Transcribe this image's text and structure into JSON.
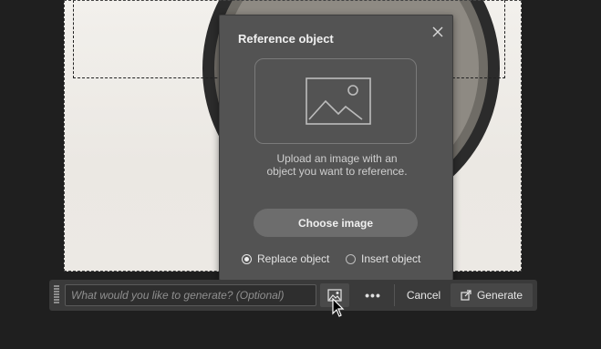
{
  "popup": {
    "title": "Reference object",
    "upload_text_line1": "Upload an image with an",
    "upload_text_line2": "object you want to reference.",
    "choose_button_label": "Choose image",
    "radio_options": [
      {
        "label": "Replace object",
        "checked": true
      },
      {
        "label": "Insert object",
        "checked": false
      }
    ],
    "close_icon": "close-icon",
    "image_placeholder_icon": "image-icon"
  },
  "taskbar": {
    "prompt_placeholder": "What would you like to generate? (Optional)",
    "prompt_value": "",
    "reference_button_icon": "image-reference-icon",
    "more_label": "•••",
    "cancel_label": "Cancel",
    "generate_label": "Generate",
    "generate_icon": "generate-icon"
  },
  "colors": {
    "background": "#1f1f1f",
    "popup_bg": "#535353",
    "taskbar_bg": "#3a3a3a",
    "button_bg": "#6d6d6d"
  }
}
